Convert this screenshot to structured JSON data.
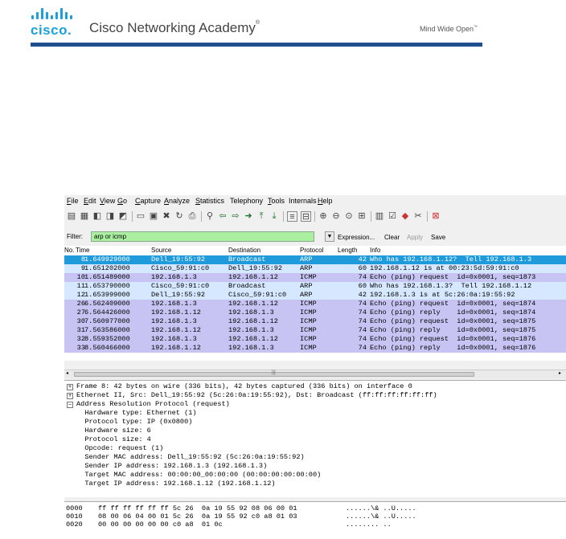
{
  "header": {
    "logo_text": "cisco.",
    "academy": "Cisco Networking Academy",
    "trademark": "®",
    "tagline": "Mind Wide Open",
    "tagline_mark": "™",
    "accent_color": "#1ba0d7",
    "rule_color": "#1d4f8f"
  },
  "menu": [
    {
      "key": "F",
      "rest": "ile"
    },
    {
      "key": "E",
      "rest": "dit"
    },
    {
      "key": "V",
      "rest": "iew"
    },
    {
      "key": "G",
      "rest": "o"
    },
    {
      "key": "C",
      "rest": "apture"
    },
    {
      "key": "A",
      "rest": "nalyze"
    },
    {
      "key": "S",
      "rest": "tatistics"
    },
    {
      "key": "",
      "rest": "Telephony"
    },
    {
      "key": "T",
      "rest": "ools"
    },
    {
      "key": "",
      "rest": "Internals"
    },
    {
      "key": "H",
      "rest": "elp"
    }
  ],
  "filter": {
    "label": "Filter:",
    "value": "arp or icmp",
    "expression": "Expression...",
    "clear": "Clear",
    "apply": "Apply",
    "save": "Save"
  },
  "columns": [
    "No.",
    "Time",
    "Source",
    "Destination",
    "Protocol",
    "Length",
    "Info"
  ],
  "packets": [
    {
      "no": "8",
      "time": "1.649929000",
      "src": "Dell_19:55:92",
      "dst": "Broadcast",
      "proto": "ARP",
      "len": "42",
      "info": "Who has 192.168.1.12?  Tell 192.168.1.3",
      "style": "sel"
    },
    {
      "no": "9",
      "time": "1.651202000",
      "src": "Cisco_59:91:c0",
      "dst": "Dell_19:55:92",
      "proto": "ARP",
      "len": "60",
      "info": "192.168.1.12 is at 00:23:5d:59:91:c0",
      "style": "arp"
    },
    {
      "no": "10",
      "time": "1.651489000",
      "src": "192.168.1.3",
      "dst": "192.168.1.12",
      "proto": "ICMP",
      "len": "74",
      "info": "Echo (ping) request  id=0x0001, seq=1873",
      "style": "icmp"
    },
    {
      "no": "11",
      "time": "1.653790000",
      "src": "Cisco_59:91:c0",
      "dst": "Broadcast",
      "proto": "ARP",
      "len": "60",
      "info": "Who has 192.168.1.3?  Tell 192.168.1.12",
      "style": "arp"
    },
    {
      "no": "12",
      "time": "1.653999000",
      "src": "Dell_19:55:92",
      "dst": "Cisco_59:91:c0",
      "proto": "ARP",
      "len": "42",
      "info": "192.168.1.3 is at 5c:26:0a:19:55:92",
      "style": "arp"
    },
    {
      "no": "26",
      "time": "6.562409000",
      "src": "192.168.1.3",
      "dst": "192.168.1.12",
      "proto": "ICMP",
      "len": "74",
      "info": "Echo (ping) request  id=0x0001, seq=1874",
      "style": "icmp"
    },
    {
      "no": "27",
      "time": "6.564426000",
      "src": "192.168.1.12",
      "dst": "192.168.1.3",
      "proto": "ICMP",
      "len": "74",
      "info": "Echo (ping) reply    id=0x0001, seq=1874",
      "style": "icmp"
    },
    {
      "no": "30",
      "time": "7.560977000",
      "src": "192.168.1.3",
      "dst": "192.168.1.12",
      "proto": "ICMP",
      "len": "74",
      "info": "Echo (ping) request  id=0x0001, seq=1875",
      "style": "icmp"
    },
    {
      "no": "31",
      "time": "7.563586000",
      "src": "192.168.1.12",
      "dst": "192.168.1.3",
      "proto": "ICMP",
      "len": "74",
      "info": "Echo (ping) reply    id=0x0001, seq=1875",
      "style": "icmp"
    },
    {
      "no": "32",
      "time": "8.559352000",
      "src": "192.168.1.3",
      "dst": "192.168.1.12",
      "proto": "ICMP",
      "len": "74",
      "info": "Echo (ping) request  id=0x0001, seq=1876",
      "style": "icmp"
    },
    {
      "no": "33",
      "time": "8.560466000",
      "src": "192.168.1.12",
      "dst": "192.168.1.3",
      "proto": "ICMP",
      "len": "74",
      "info": "Echo (ping) reply    id=0x0001, seq=1876",
      "style": "icmp"
    }
  ],
  "details": [
    {
      "toggle": "+",
      "text": "Frame 8: 42 bytes on wire (336 bits), 42 bytes captured (336 bits) on interface 0"
    },
    {
      "toggle": "+",
      "text": "Ethernet II, Src: Dell_19:55:92 (5c:26:0a:19:55:92), Dst: Broadcast (ff:ff:ff:ff:ff:ff)"
    },
    {
      "toggle": "−",
      "text": "Address Resolution Protocol (request)"
    },
    {
      "toggle": "",
      "text": "  Hardware type: Ethernet (1)"
    },
    {
      "toggle": "",
      "text": "  Protocol type: IP (0x0800)"
    },
    {
      "toggle": "",
      "text": "  Hardware size: 6"
    },
    {
      "toggle": "",
      "text": "  Protocol size: 4"
    },
    {
      "toggle": "",
      "text": "  Opcode: request (1)"
    },
    {
      "toggle": "",
      "text": "  Sender MAC address: Dell_19:55:92 (5c:26:0a:19:55:92)"
    },
    {
      "toggle": "",
      "text": "  Sender IP address: 192.168.1.3 (192.168.1.3)"
    },
    {
      "toggle": "",
      "text": "  Target MAC address: 00:00:00_00:00:00 (00:00:00:00:00:00)"
    },
    {
      "toggle": "",
      "text": "  Target IP address: 192.168.1.12 (192.168.1.12)"
    }
  ],
  "hex": [
    {
      "offset": "0000",
      "bytes": "ff ff ff ff ff ff 5c 26  0a 19 55 92 08 06 00 01",
      "ascii": "......\\& ..U....."
    },
    {
      "offset": "0010",
      "bytes": "08 00 06 04 00 01 5c 26  0a 19 55 92 c0 a8 01 03",
      "ascii": "......\\& ..U....."
    },
    {
      "offset": "0020",
      "bytes": "00 00 00 00 00 00 c0 a8  01 0c",
      "ascii": "........ .."
    }
  ]
}
